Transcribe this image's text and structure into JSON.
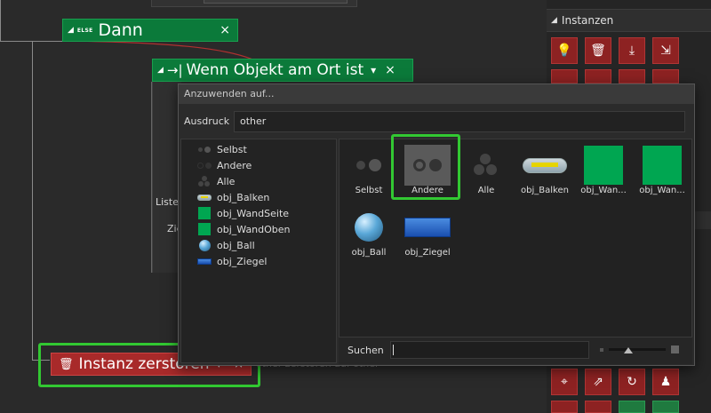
{
  "dann_block": {
    "small_label": "ELSE",
    "title": "Dann",
    "close": "×"
  },
  "wenn_block": {
    "arrow": "→|",
    "title": "Wenn Objekt am Ort ist",
    "dropdown": "▾",
    "close": "×"
  },
  "hidden_labels": {
    "liste": "Liste",
    "zie": "Zie"
  },
  "instanz_block": {
    "title": "Instanz zerstören",
    "dropdown": "▾",
    "close": "×",
    "trailing_text": "other zerstören auf other"
  },
  "right_panel": {
    "section_title": "Instanzen"
  },
  "dialog": {
    "title": "Anzuwenden auf...",
    "expression_label": "Ausdruck",
    "expression_value": "other",
    "list": [
      {
        "label": "Selbst",
        "icon": "self-dots"
      },
      {
        "label": "Andere",
        "icon": "other-dots"
      },
      {
        "label": "Alle",
        "icon": "all-dots"
      },
      {
        "label": "obj_Balken",
        "icon": "paddle"
      },
      {
        "label": "obj_WandSeite",
        "icon": "green-square"
      },
      {
        "label": "obj_WandOben",
        "icon": "green-square"
      },
      {
        "label": "obj_Ball",
        "icon": "ball"
      },
      {
        "label": "obj_Ziegel",
        "icon": "brick"
      }
    ],
    "grid": [
      {
        "label": "Selbst",
        "icon": "self-dots"
      },
      {
        "label": "Andere",
        "icon": "other-dots",
        "selected": true
      },
      {
        "label": "Alle",
        "icon": "all-dots"
      },
      {
        "label": "obj_Balken",
        "icon": "paddle"
      },
      {
        "label": "obj_Wan...",
        "icon": "green-square"
      },
      {
        "label": "obj_Wan...",
        "icon": "green-square"
      },
      {
        "label": "obj_Ball",
        "icon": "ball"
      },
      {
        "label": "obj_Ziegel",
        "icon": "brick"
      }
    ],
    "search_label": "Suchen",
    "search_value": ""
  },
  "colors": {
    "action_green": "#0b7a3a",
    "action_red": "#a82a2a",
    "highlight": "#32c832",
    "object_green": "#00a651"
  }
}
